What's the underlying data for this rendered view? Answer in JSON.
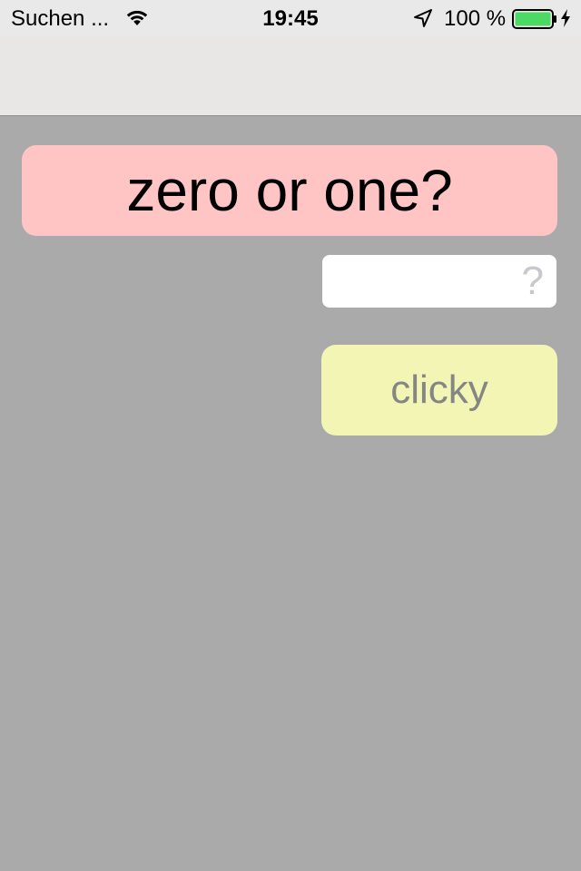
{
  "status_bar": {
    "carrier": "Suchen ...",
    "time": "19:45",
    "battery_percent": "100 %",
    "battery_level": 1.0,
    "icons": [
      "wifi-icon",
      "location-icon",
      "battery-icon",
      "charging-icon"
    ]
  },
  "main": {
    "question": "zero or one?",
    "answer_placeholder": "?",
    "answer_value": "",
    "button_label": "clicky"
  },
  "colors": {
    "background": "#aaaaaa",
    "status_bar": "#e9e9e9",
    "nav_bar": "#e8e7e6",
    "question_bg": "#ffc4c4",
    "button_bg": "#f2f5b4",
    "button_text": "#858585",
    "battery_fill": "#4cd964"
  }
}
